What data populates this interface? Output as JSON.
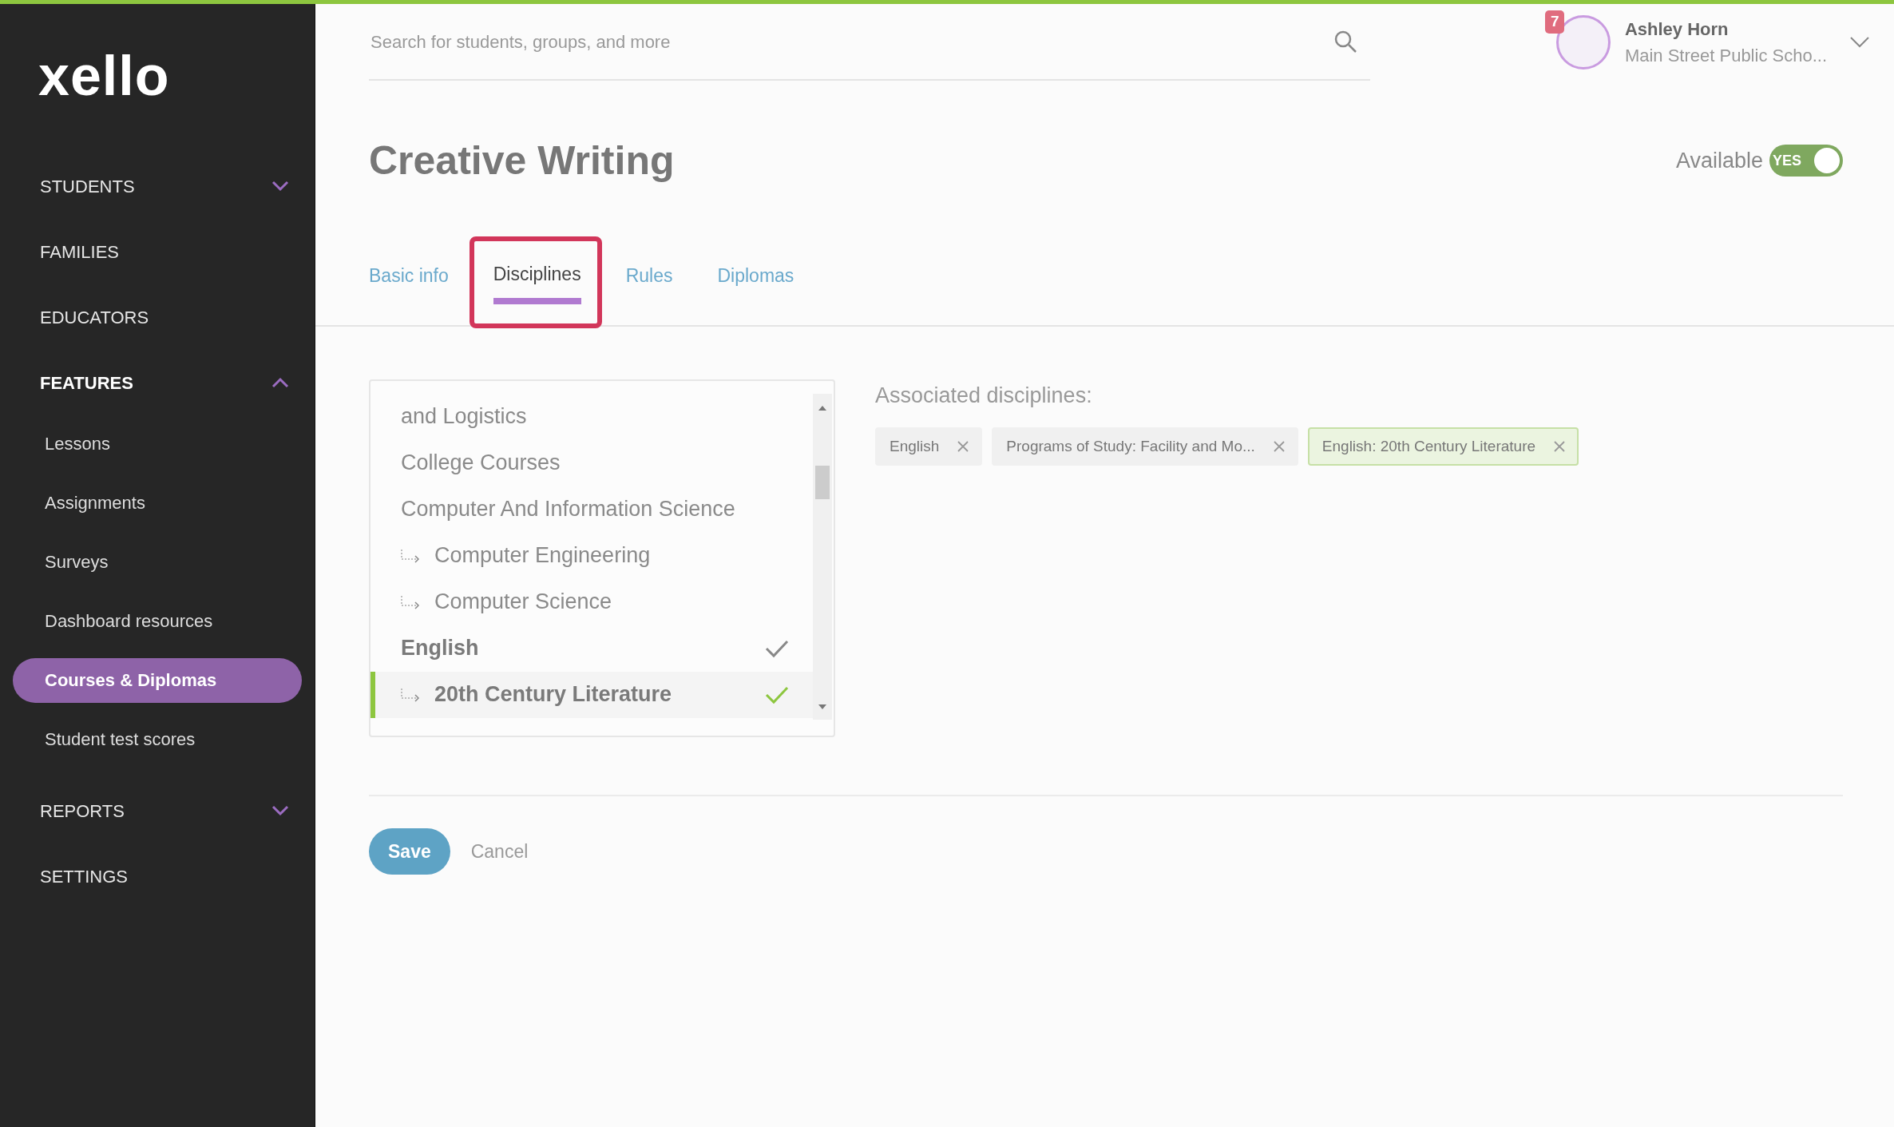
{
  "logo": "xello",
  "sidebar": {
    "items": [
      {
        "label": "STUDENTS",
        "expanded": false
      },
      {
        "label": "FAMILIES"
      },
      {
        "label": "EDUCATORS"
      },
      {
        "label": "FEATURES",
        "expanded": true,
        "children": [
          {
            "label": "Lessons",
            "selected": false
          },
          {
            "label": "Assignments",
            "selected": false
          },
          {
            "label": "Surveys",
            "selected": false
          },
          {
            "label": "Dashboard resources",
            "selected": false
          },
          {
            "label": "Courses & Diplomas",
            "selected": true
          },
          {
            "label": "Student test scores",
            "selected": false
          }
        ]
      },
      {
        "label": "REPORTS",
        "expanded": false
      },
      {
        "label": "SETTINGS"
      }
    ]
  },
  "search": {
    "placeholder": "Search for students, groups, and more"
  },
  "user": {
    "name": "Ashley Horn",
    "school": "Main Street Public Scho...",
    "notifications": "7"
  },
  "page": {
    "title": "Creative Writing",
    "available_label": "Available",
    "available_toggle": {
      "on": true,
      "text": "YES"
    }
  },
  "tabs": [
    {
      "label": "Basic info",
      "selected": false
    },
    {
      "label": "Disciplines",
      "selected": true
    },
    {
      "label": "Rules",
      "selected": false
    },
    {
      "label": "Diplomas",
      "selected": false
    }
  ],
  "discipline_list": [
    {
      "label": "and Logistics",
      "checked": false,
      "selected": false
    },
    {
      "label": "College Courses",
      "checked": false,
      "selected": false
    },
    {
      "label": "Computer And Information Science",
      "checked": false,
      "selected": false,
      "children": [
        {
          "label": "Computer Engineering",
          "checked": false,
          "selected": false
        },
        {
          "label": "Computer Science",
          "checked": false,
          "selected": false
        }
      ]
    },
    {
      "label": "English",
      "checked": true,
      "selected": false,
      "children": [
        {
          "label": "20th Century Literature",
          "checked": true,
          "selected": true
        }
      ]
    }
  ],
  "associated": {
    "heading": "Associated disciplines:",
    "tags": [
      {
        "label": "English",
        "selected": false
      },
      {
        "label": "Programs of Study: Facility and Mo...",
        "selected": false
      },
      {
        "label": "English: 20th Century Literature",
        "selected": true
      }
    ]
  },
  "buttons": {
    "save": "Save",
    "cancel": "Cancel"
  }
}
